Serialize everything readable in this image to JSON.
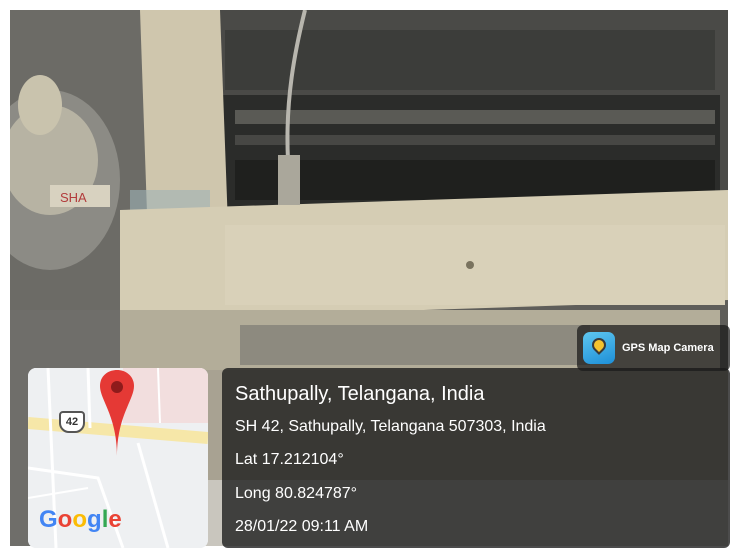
{
  "badge": {
    "app_name": "GPS Map Camera",
    "icon": "gps-camera-app-icon"
  },
  "map": {
    "provider_logo": "Google",
    "road_shield": "42",
    "logo_colors": [
      "#4285F4",
      "#EA4335",
      "#FBBC05",
      "#4285F4",
      "#34A853",
      "#EA4335"
    ],
    "marker_color": "#E53935"
  },
  "location": {
    "title": "Sathupally, Telangana, India",
    "address": "SH 42, Sathupally, Telangana 507303, India",
    "latitude": "Lat 17.212104°",
    "longitude": "Long 80.824787°",
    "timestamp": "28/01/22 09:11 AM"
  },
  "photo": {
    "sticker_text": "SHA"
  }
}
